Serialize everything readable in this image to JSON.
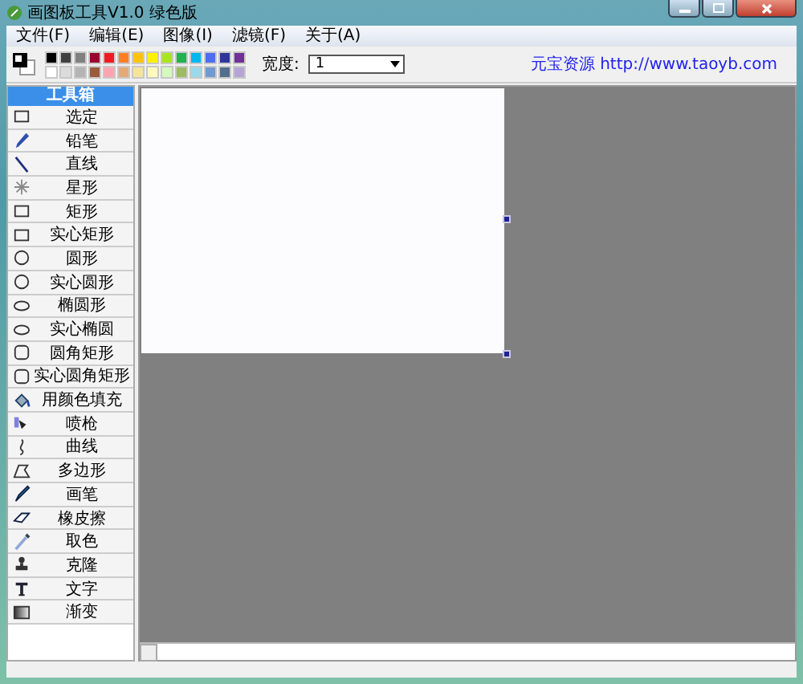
{
  "window": {
    "title": "画图板工具V1.0 绿色版"
  },
  "menu": [
    "文件(F)",
    "编辑(E)",
    "图像(I)",
    "滤镜(F)",
    "关于(A)"
  ],
  "toolbar": {
    "palette": [
      {
        "color": "#000000"
      },
      {
        "color": "#404040"
      },
      {
        "color": "#808080"
      },
      {
        "color": "#990030"
      },
      {
        "color": "#ed1c24"
      },
      {
        "color": "#ff7f27"
      },
      {
        "color": "#ffc20e"
      },
      {
        "color": "#fff200"
      },
      {
        "color": "#a8e61d"
      },
      {
        "color": "#22b14c"
      },
      {
        "color": "#00b7ef"
      },
      {
        "color": "#4d6df3"
      },
      {
        "color": "#2f3699"
      },
      {
        "color": "#6f3198"
      },
      {
        "color": "#ffffff"
      },
      {
        "color": "#dcdcdc"
      },
      {
        "color": "#b4b4b4"
      },
      {
        "color": "#9c5a3c"
      },
      {
        "color": "#ffa3b1"
      },
      {
        "color": "#e5aa7a"
      },
      {
        "color": "#f5e49c"
      },
      {
        "color": "#fff9bd"
      },
      {
        "color": "#d3f9bc"
      },
      {
        "color": "#9dbb61"
      },
      {
        "color": "#99d9ea"
      },
      {
        "color": "#709ad1"
      },
      {
        "color": "#546d8e"
      },
      {
        "color": "#b5a5d5"
      }
    ],
    "width_label": "宽度:",
    "width_value": "1",
    "link": "元宝资源 http://www.taoyb.com"
  },
  "toolbox": {
    "title": "工具箱",
    "tools": [
      {
        "label": "选定",
        "kind": "rect"
      },
      {
        "label": "铅笔",
        "kind": "pencil"
      },
      {
        "label": "直线",
        "kind": "line"
      },
      {
        "label": "星形",
        "kind": "star"
      },
      {
        "label": "矩形",
        "kind": "rect"
      },
      {
        "label": "实心矩形",
        "kind": "rect"
      },
      {
        "label": "圆形",
        "kind": "circle"
      },
      {
        "label": "实心圆形",
        "kind": "circle"
      },
      {
        "label": "椭圆形",
        "kind": "ellipse"
      },
      {
        "label": "实心椭圆",
        "kind": "ellipse"
      },
      {
        "label": "圆角矩形",
        "kind": "roundrect"
      },
      {
        "label": "实心圆角矩形",
        "kind": "roundrect"
      },
      {
        "label": "用颜色填充",
        "kind": "bucket"
      },
      {
        "label": "喷枪",
        "kind": "spray"
      },
      {
        "label": "曲线",
        "kind": "curve"
      },
      {
        "label": "多边形",
        "kind": "polygon"
      },
      {
        "label": "画笔",
        "kind": "brush"
      },
      {
        "label": "橡皮擦",
        "kind": "eraser"
      },
      {
        "label": "取色",
        "kind": "picker"
      },
      {
        "label": "克隆",
        "kind": "stamp"
      },
      {
        "label": "文字",
        "kind": "text"
      },
      {
        "label": "渐变",
        "kind": "gradient"
      }
    ]
  }
}
